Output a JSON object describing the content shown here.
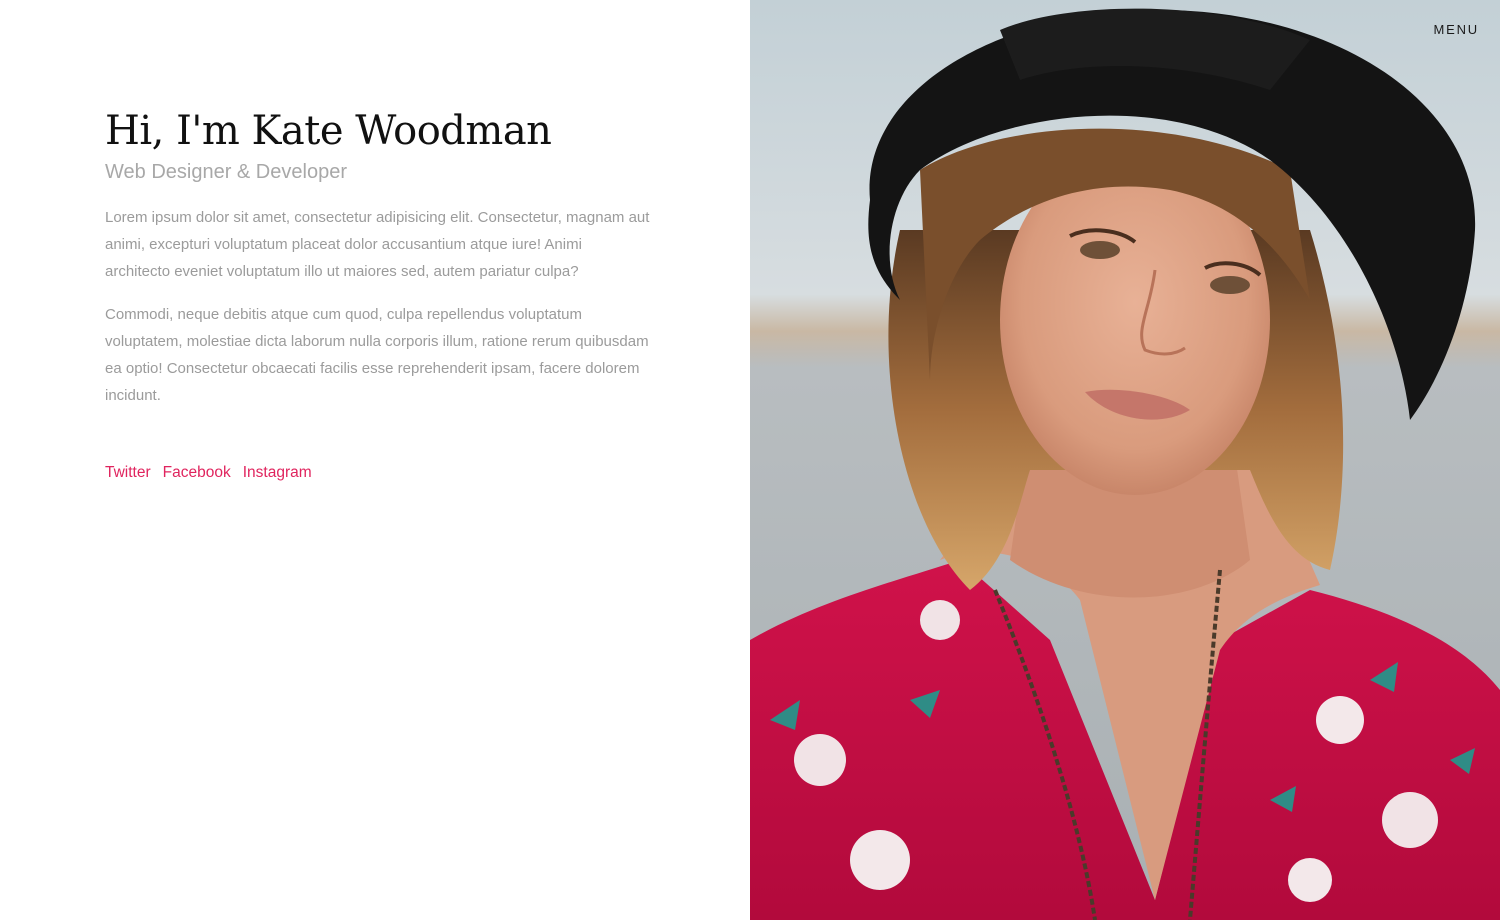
{
  "nav": {
    "menu_label": "MENU"
  },
  "intro": {
    "title": "Hi, I'm Kate Woodman",
    "subtitle": "Web Designer & Developer",
    "paragraphs": [
      "Lorem ipsum dolor sit amet, consectetur adipisicing elit. Consectetur, magnam aut animi, excepturi voluptatum placeat dolor accusantium atque iure! Animi architecto eveniet voluptatum illo ut maiores sed, autem pariatur culpa?",
      "Commodi, neque debitis atque cum quod, culpa repellendus voluptatum voluptatem, molestiae dicta laborum nulla corporis illum, ratione rerum quibusdam ea optio! Consectetur obcaecati facilis esse reprehenderit ipsam, facere dolorem incidunt."
    ]
  },
  "social": [
    {
      "label": "Twitter"
    },
    {
      "label": "Facebook"
    },
    {
      "label": "Instagram"
    }
  ],
  "colors": {
    "accent": "#e0245e",
    "title": "#111111",
    "muted_text": "#9b9b9b",
    "background": "#ffffff"
  },
  "icons": {
    "photo": "portrait-photo"
  }
}
